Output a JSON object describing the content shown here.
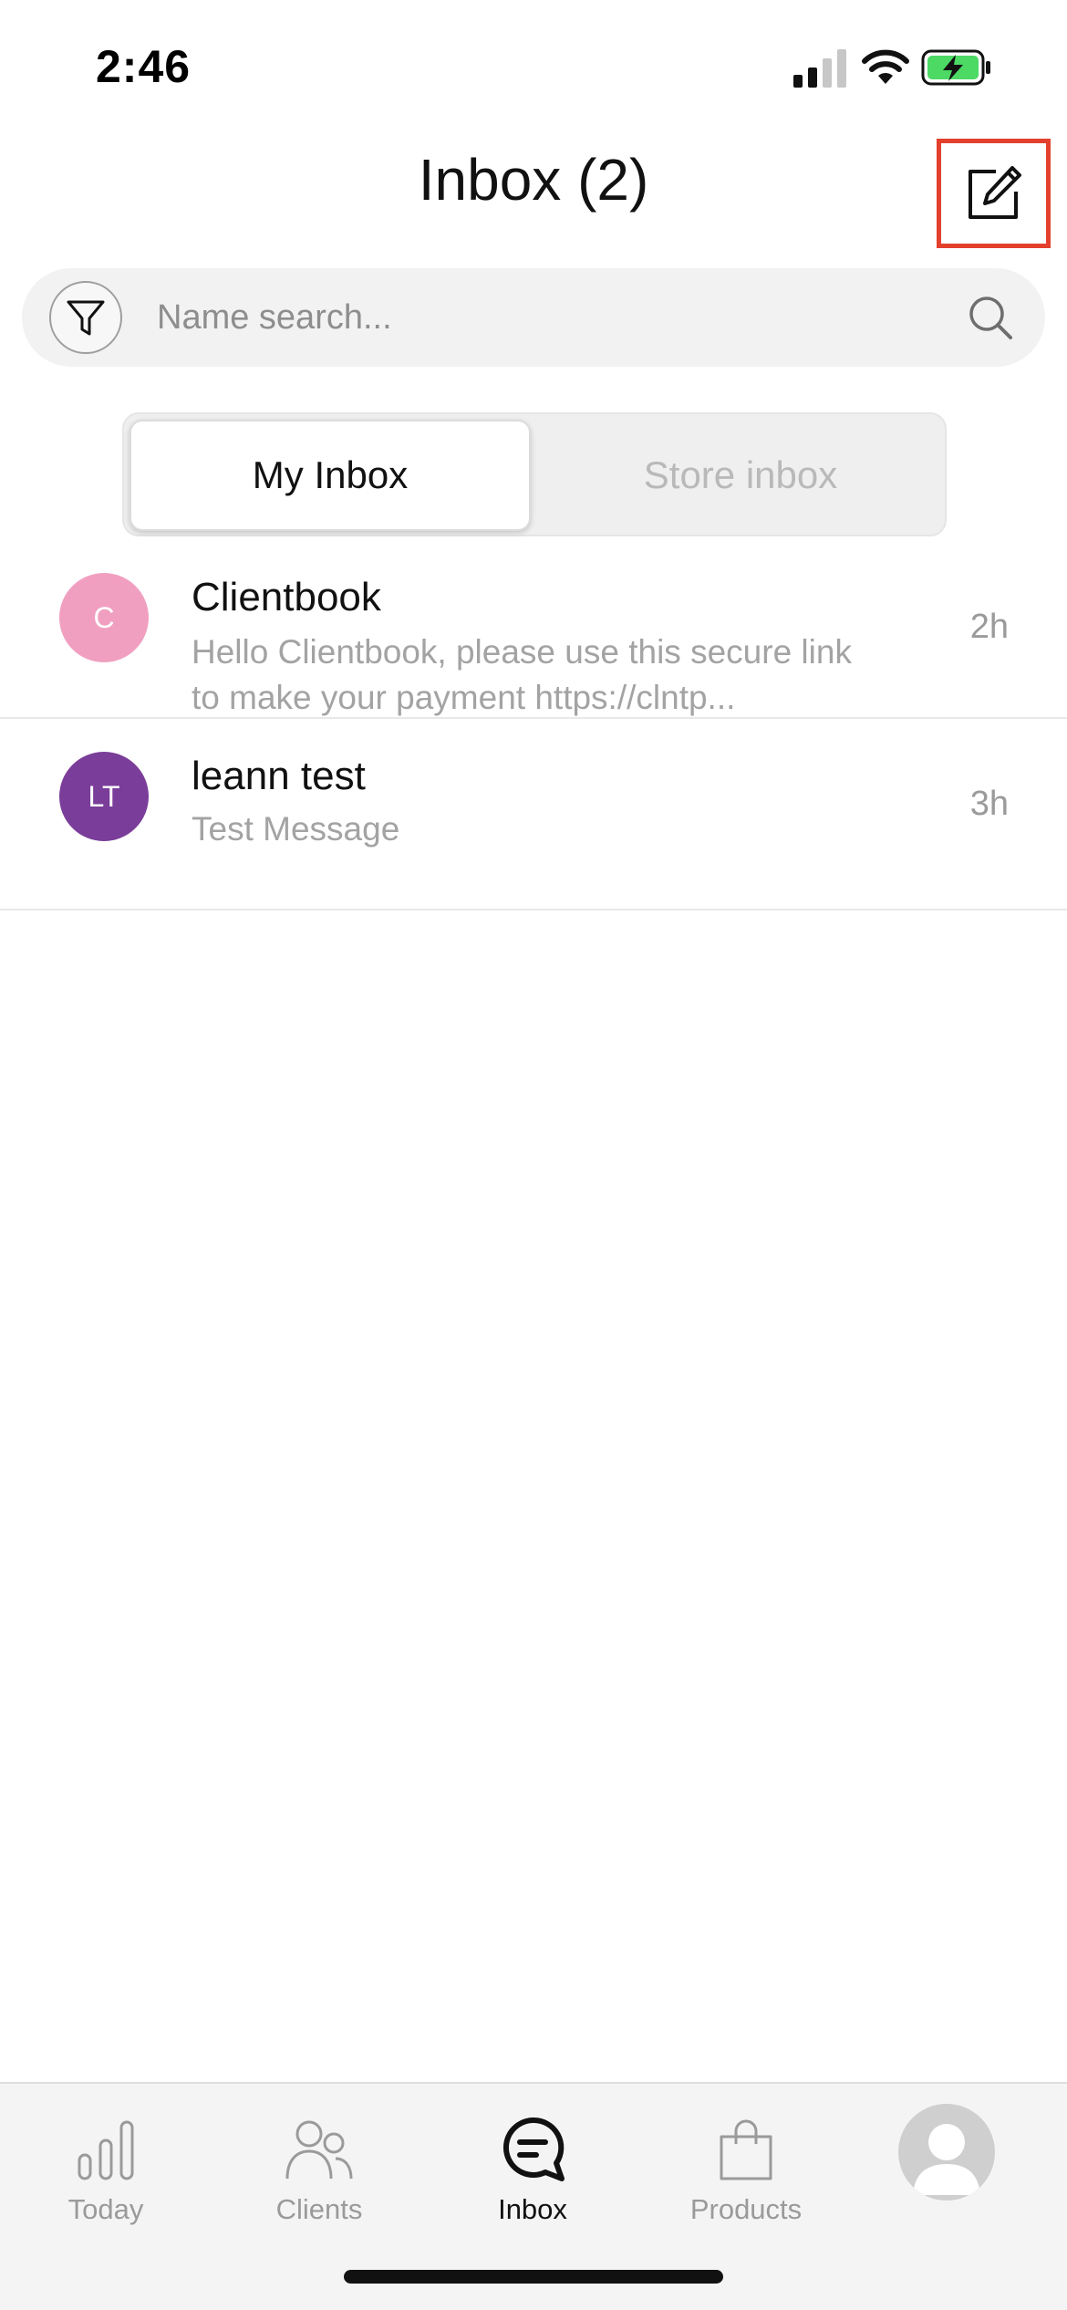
{
  "status_bar": {
    "time": "2:46"
  },
  "header": {
    "title": "Inbox (2)"
  },
  "search": {
    "placeholder": "Name search..."
  },
  "segments": {
    "active": "My Inbox",
    "inactive": "Store inbox"
  },
  "conversations": [
    {
      "initials": "C",
      "avatar_color": "#f19fc0",
      "name": "Clientbook",
      "preview": "Hello Clientbook, please use this secure link to make your payment https://clntp...",
      "time": "2h"
    },
    {
      "initials": "LT",
      "avatar_color": "#7a3d99",
      "name": "leann test",
      "preview": "Test Message",
      "time": "3h"
    }
  ],
  "tab_bar": {
    "today": "Today",
    "clients": "Clients",
    "inbox": "Inbox",
    "products": "Products"
  },
  "colors": {
    "highlight": "#e3402d",
    "battery": "#4cd964"
  }
}
